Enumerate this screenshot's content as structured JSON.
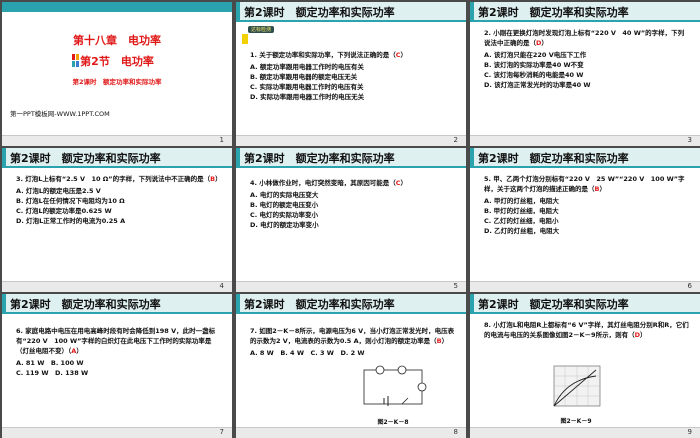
{
  "header_title": "第2课时　额定功率和实际功率",
  "cover": {
    "chapter": "第十八章　电功率",
    "section": "第2节　电功率",
    "lesson": "第2课时　额定功率和实际功率",
    "site": "第一PPT模板网-WWW.1PPT.COM",
    "page": "1"
  },
  "s2": {
    "badge": "达标检测",
    "q": "1. 关于额定功率和实际功率，下列说法正确的是（",
    "ans": "C",
    "q_end": "）",
    "opts": [
      "A. 额定功率跟用电器工作时的电压有关",
      "B. 额定功率跟用电器的额定电压无关",
      "C. 实际功率跟用电器工作时的电压有关",
      "D. 实际功率跟用电器工作时的电压无关"
    ],
    "page": "2"
  },
  "s3": {
    "q": "2. 小刚在更换灯泡时发现灯泡上标有“220 V　40 W”的字样，下列说法中正确的是（",
    "ans": "D",
    "q_end": "）",
    "opts": [
      "A. 该灯泡只能在220 V电压下工作",
      "B. 该灯泡的实际功率是40 W不变",
      "C. 该灯泡每秒消耗的电能是40 W",
      "D. 该灯泡正常发光时的功率是40 W"
    ],
    "page": "3"
  },
  "s4": {
    "q": "3. 灯泡L上标有“2.5 V　10 Ω”的字样，下列说法中不正确的是（",
    "ans": "B",
    "q_end": "）",
    "opts": [
      "A. 灯泡L的额定电压是2.5 V",
      "B. 灯泡L在任何情况下电阻均为10 Ω",
      "C. 灯泡L的额定功率是0.625 W",
      "D. 灯泡L正常工作时的电流为0.25 A"
    ],
    "page": "4"
  },
  "s5": {
    "q": "4. 小林做作业时，电灯突然变暗，其原因可能是（",
    "ans": "C",
    "q_end": "）",
    "opts": [
      "A. 电灯的实际电压变大",
      "B. 电灯的额定电压变小",
      "C. 电灯的实际功率变小",
      "D. 电灯的额定功率变小"
    ],
    "page": "5"
  },
  "s6": {
    "q": "5. 甲、乙两个灯泡分别标有“220 V　25 W”“220 V　100 W”字样，关于这两个灯泡的描述正确的是（",
    "ans": "B",
    "q_end": "）",
    "opts": [
      "A. 甲灯的灯丝粗，电阻大",
      "B. 甲灯的灯丝细，电阻大",
      "C. 乙灯的灯丝细，电阻小",
      "D. 乙灯的灯丝粗，电阻大"
    ],
    "page": "6"
  },
  "s7": {
    "q": "6. 家庭电路中电压在用电高峰时段有时会降低到198 V，此时一盏标有“220 V　100 W”字样的白炽灯在此电压下工作时的实际功率是（灯丝电阻不变）（",
    "ans": "A",
    "q_end": "）",
    "opts": [
      "A. 81 W",
      "B. 100 W",
      "C. 119 W",
      "D. 138 W"
    ],
    "page": "7"
  },
  "s8": {
    "q": "7. 如图2－K－8所示，电源电压为6 V，当小灯泡正常发光时，电压表的示数为2 V，电流表的示数为0.5 A，则小灯泡的额定功率是（",
    "ans": "B",
    "q_end": "）",
    "opts": [
      "A. 8 W",
      "B. 4 W",
      "C. 3 W",
      "D. 2 W"
    ],
    "fig": "图2－K－8",
    "page": "8"
  },
  "s9": {
    "q": "8. 小灯泡L和电阻R上都标有“6 V”字样，其灯丝电阻分别R和R，它们的电流与电压的关系图像如图2－K－9所示，则有（",
    "ans": "D",
    "q_end": "）",
    "fig": "图2－K－9",
    "page": "9"
  }
}
